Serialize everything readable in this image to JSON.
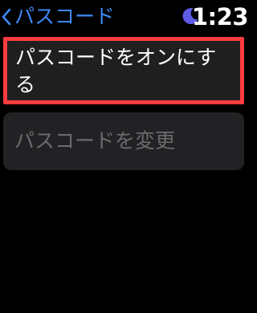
{
  "header": {
    "back_label": "パスコード",
    "time": "1:23",
    "focus_icon": "moon-icon"
  },
  "colors": {
    "accent": "#3c89f5",
    "moon": "#5e5ce6",
    "highlight_border": "#ff3b3f",
    "cell_background": "#222224",
    "disabled_text": "#6b6b6e"
  },
  "list": {
    "items": [
      {
        "label": "パスコードをオンにする",
        "enabled": true
      },
      {
        "label": "パスコードを変更",
        "enabled": false
      }
    ]
  }
}
